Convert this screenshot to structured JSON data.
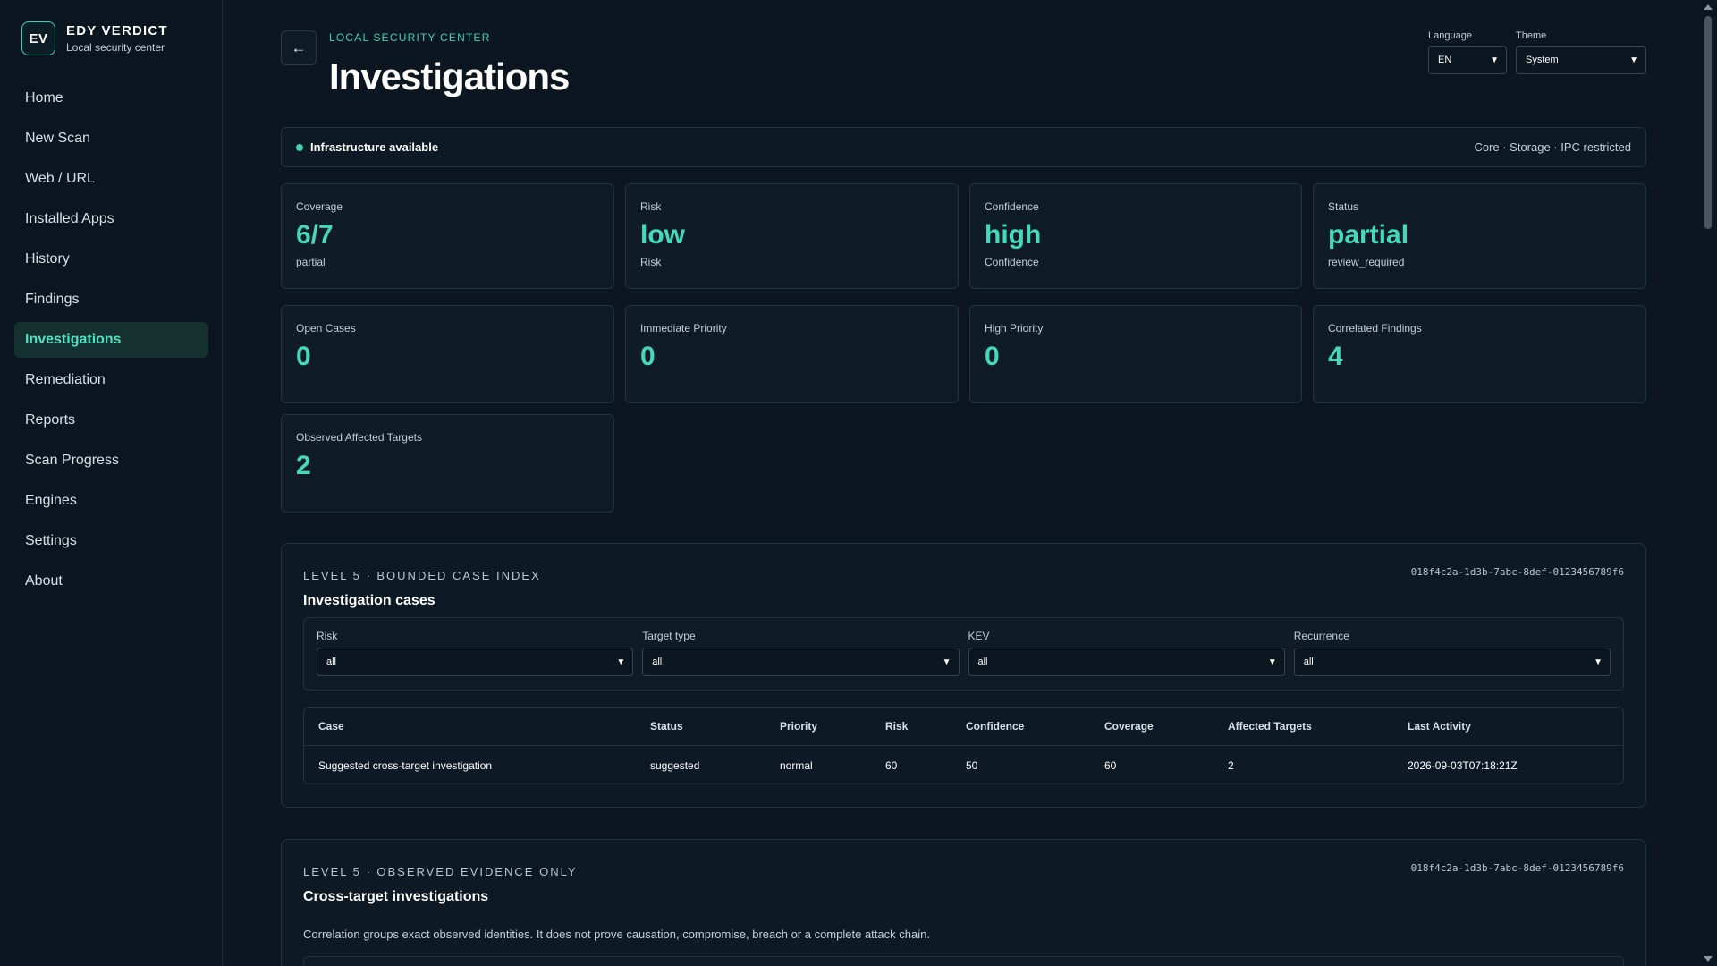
{
  "brand": {
    "logo": "EV",
    "name": "EDY VERDICT",
    "subtitle": "Local security center"
  },
  "sidebar": {
    "items": [
      {
        "label": "Home"
      },
      {
        "label": "New Scan"
      },
      {
        "label": "Web / URL"
      },
      {
        "label": "Installed Apps"
      },
      {
        "label": "History"
      },
      {
        "label": "Findings"
      },
      {
        "label": "Investigations",
        "active": true
      },
      {
        "label": "Remediation"
      },
      {
        "label": "Reports"
      },
      {
        "label": "Scan Progress"
      },
      {
        "label": "Engines"
      },
      {
        "label": "Settings"
      },
      {
        "label": "About"
      }
    ]
  },
  "header": {
    "back_icon": "←",
    "eyebrow": "LOCAL SECURITY CENTER",
    "title": "Investigations",
    "language": {
      "label": "Language",
      "value": "EN"
    },
    "theme": {
      "label": "Theme",
      "value": "System"
    }
  },
  "status": {
    "text": "Infrastructure available",
    "detail": "Core · Storage · IPC restricted",
    "color": "#3fd1b4"
  },
  "summary_cards": [
    {
      "label": "Coverage",
      "value": "6/7",
      "sub": "partial"
    },
    {
      "label": "Risk",
      "value": "low",
      "sub": "Risk"
    },
    {
      "label": "Confidence",
      "value": "high",
      "sub": "Confidence"
    },
    {
      "label": "Status",
      "value": "partial",
      "sub": "review_required"
    }
  ],
  "metric_cards": [
    {
      "label": "Open Cases",
      "value": "0"
    },
    {
      "label": "Immediate Priority",
      "value": "0"
    },
    {
      "label": "High Priority",
      "value": "0"
    },
    {
      "label": "Correlated Findings",
      "value": "4"
    },
    {
      "label": "Observed Affected Targets",
      "value": "2"
    }
  ],
  "cases_panel": {
    "eyebrow": "LEVEL 5 · BOUNDED CASE INDEX",
    "id": "018f4c2a-1d3b-7abc-8def-0123456789f6",
    "title": "Investigation cases",
    "filters": [
      {
        "label": "Risk",
        "value": "all"
      },
      {
        "label": "Target type",
        "value": "all"
      },
      {
        "label": "KEV",
        "value": "all"
      },
      {
        "label": "Recurrence",
        "value": "all"
      }
    ],
    "columns": [
      "Case",
      "Status",
      "Priority",
      "Risk",
      "Confidence",
      "Coverage",
      "Affected Targets",
      "Last Activity"
    ],
    "rows": [
      [
        "Suggested cross-target investigation",
        "suggested",
        "normal",
        "60",
        "50",
        "60",
        "2",
        "2026-09-03T07:18:21Z"
      ]
    ]
  },
  "cross_panel": {
    "eyebrow": "LEVEL 5 · OBSERVED EVIDENCE ONLY",
    "id": "018f4c2a-1d3b-7abc-8def-0123456789f6",
    "title": "Cross-target investigations",
    "description": "Correlation groups exact observed identities. It does not prove causation, compromise, breach or a complete attack chain."
  },
  "colors": {
    "accent": "#3fd1b4",
    "background": "#0b1621",
    "panel": "#0d1a25"
  }
}
